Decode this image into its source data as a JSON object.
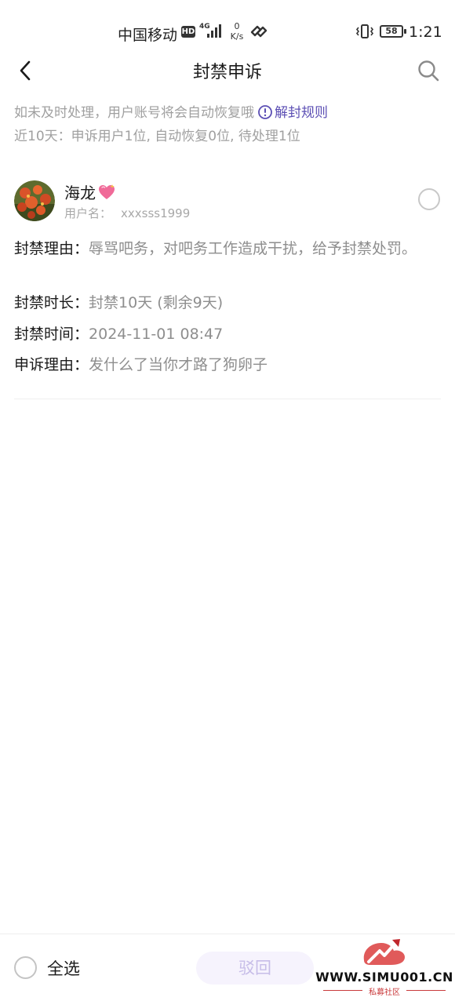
{
  "status_bar": {
    "carrier": "中国移动",
    "hd": "HD",
    "network_type": "4G",
    "net_speed_value": "0",
    "net_speed_unit": "K/s",
    "battery": "58",
    "time": "1:21"
  },
  "header": {
    "title": "封禁申诉"
  },
  "notice": {
    "text": "如未及时处理，用户账号将会自动恢复哦",
    "rules_link": "解封规则",
    "stats": "近10天：申诉用户1位, 自动恢复0位, 待处理1位"
  },
  "appeal": {
    "nickname": "海龙",
    "username_label": "用户名：",
    "username": "xxxsss1999",
    "reason_label": "封禁理由：",
    "reason": "辱骂吧务，对吧务工作造成干扰，给予封禁处罚。",
    "duration_label": "封禁时长：",
    "duration": "封禁10天 (剩余9天)",
    "time_label": "封禁时间：",
    "time": "2024-11-01 08:47",
    "appeal_label": "申诉理由：",
    "appeal_reason": "发什么了当你才路了狗卵子"
  },
  "bottom_bar": {
    "select_all": "全选",
    "reject": "驳回"
  },
  "watermark": {
    "site": "WWW.SIMU001.CN",
    "sub": "私募社区"
  },
  "colors": {
    "accent": "#5c4fb4",
    "muted_text": "#a0a0a0",
    "reject_bg": "#f6f3fd",
    "reject_text": "#c7bde8"
  }
}
